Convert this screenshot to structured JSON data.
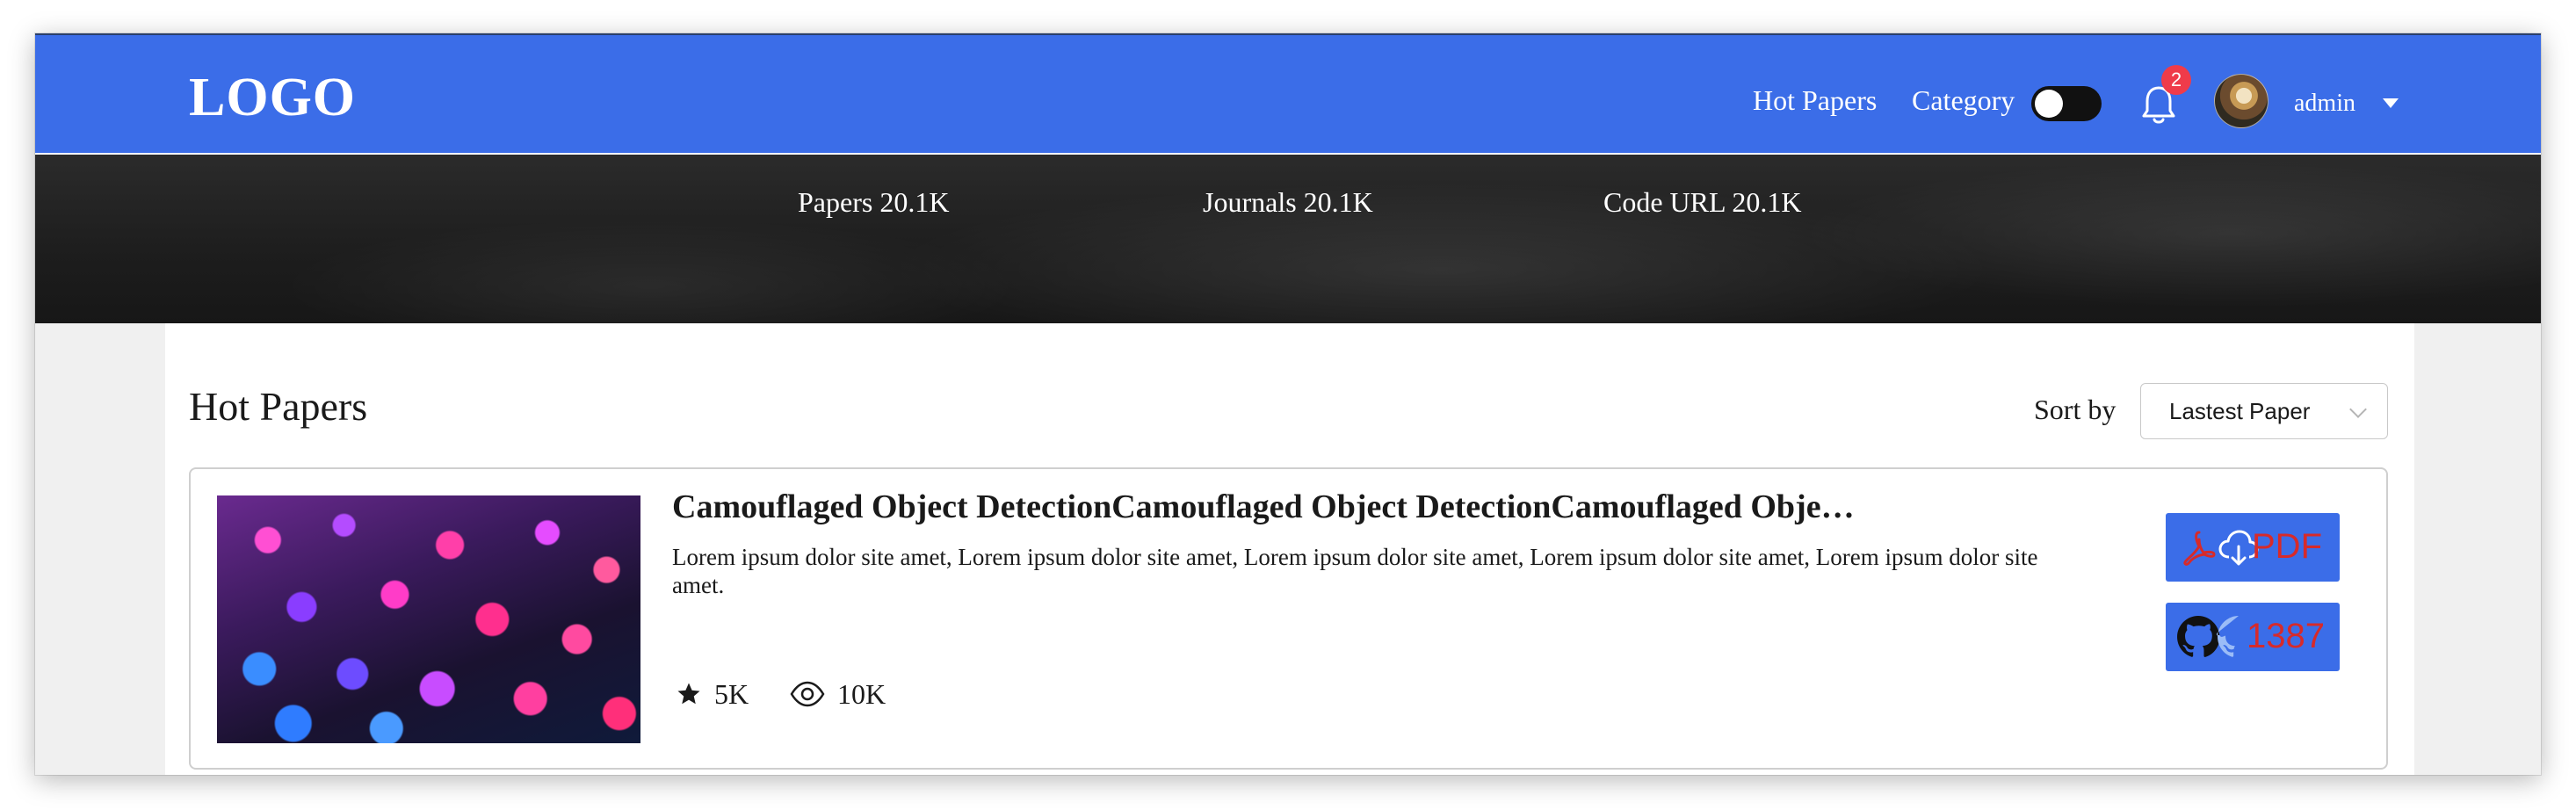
{
  "header": {
    "logo": "LOGO",
    "nav": [
      "Hot Papers",
      "Category"
    ],
    "notification_count": "2",
    "user": "admin"
  },
  "stats": {
    "papers": "Papers 20.1K",
    "journals": "Journals 20.1K",
    "code_url": "Code URL 20.1K"
  },
  "section": {
    "title": "Hot Papers",
    "sort_label": "Sort by",
    "sort_value": "Lastest Paper"
  },
  "papers": [
    {
      "title": "Camouflaged Object DetectionCamouflaged Object DetectionCamouflaged Object…",
      "abstract": "Lorem ipsum dolor site amet, Lorem ipsum dolor site amet, Lorem ipsum dolor site amet, Lorem ipsum dolor site amet, Lorem ipsum dolor site amet.",
      "stars": "5K",
      "views": "10K",
      "pdf_label": "PDF",
      "code_count": "1387"
    }
  ],
  "colors": {
    "primary": "#3b6de8",
    "badge": "#ef3b4a",
    "button_text": "#d72a2a",
    "hero": "#1d1d1d"
  },
  "icons": [
    "bell-icon",
    "chevron-down-icon",
    "star-icon",
    "eye-icon",
    "pdf-icon",
    "cloud-download-icon",
    "github-icon"
  ]
}
